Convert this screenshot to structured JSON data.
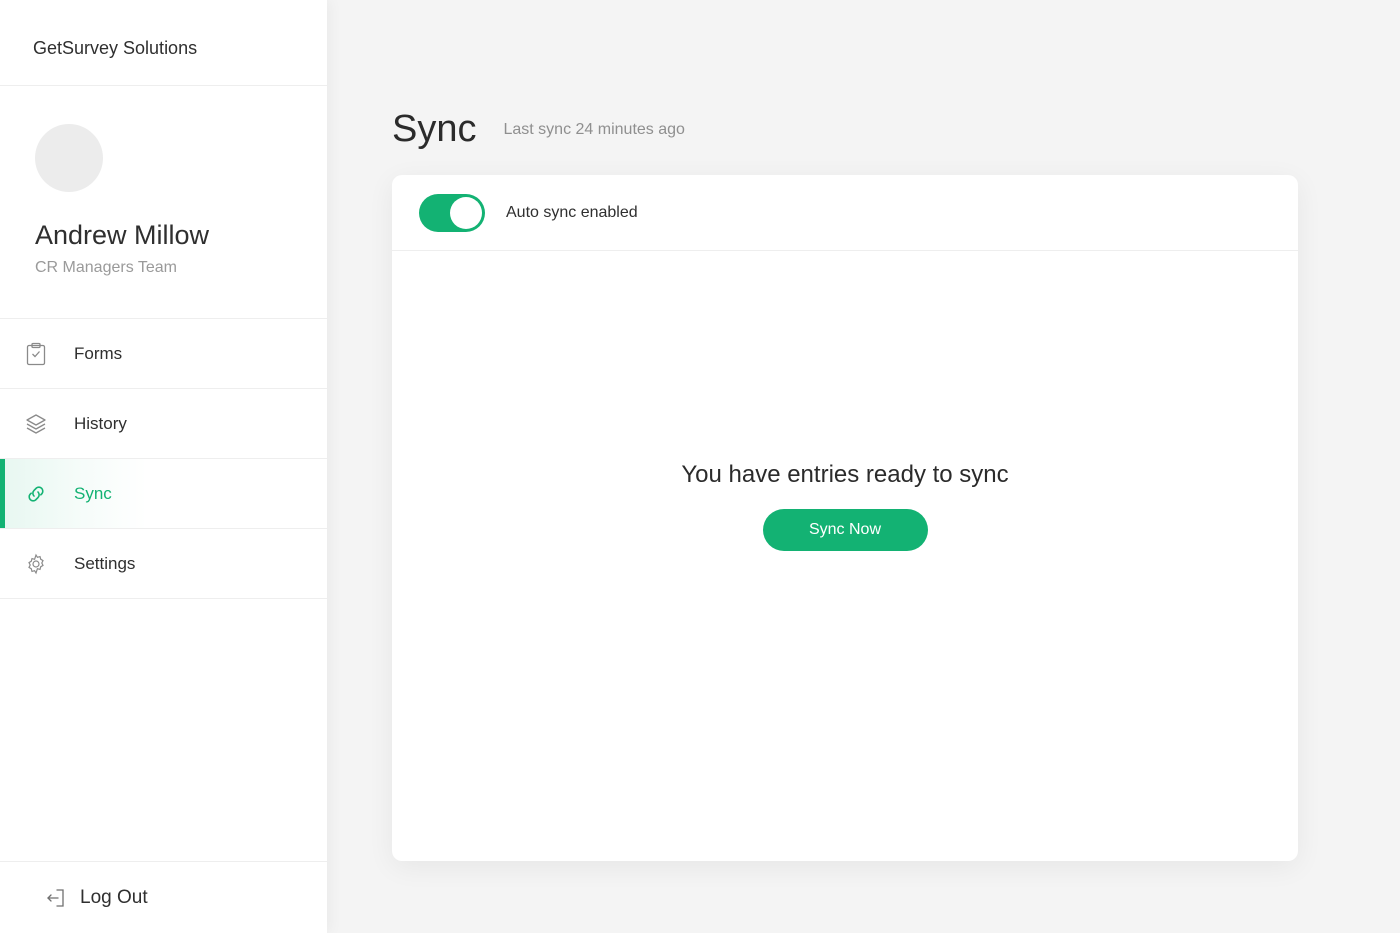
{
  "brand": {
    "name": "GetSurvey Solutions"
  },
  "profile": {
    "name": "Andrew Millow",
    "team": "CR Managers Team"
  },
  "nav": {
    "items": [
      {
        "label": "Forms",
        "icon": "clipboard-check-icon"
      },
      {
        "label": "History",
        "icon": "layers-icon"
      },
      {
        "label": "Sync",
        "icon": "link-icon",
        "active": true
      },
      {
        "label": "Settings",
        "icon": "gear-icon"
      }
    ],
    "logout_label": "Log Out"
  },
  "page": {
    "title": "Sync",
    "last_sync": "Last sync 24 minutes ago"
  },
  "card": {
    "auto_sync_label": "Auto sync enabled",
    "auto_sync_enabled": true,
    "ready_message": "You have entries ready to sync",
    "sync_button_label": "Sync Now"
  },
  "colors": {
    "accent": "#13b273",
    "background": "#f4f4f4",
    "muted_text": "#9a9a9a"
  }
}
